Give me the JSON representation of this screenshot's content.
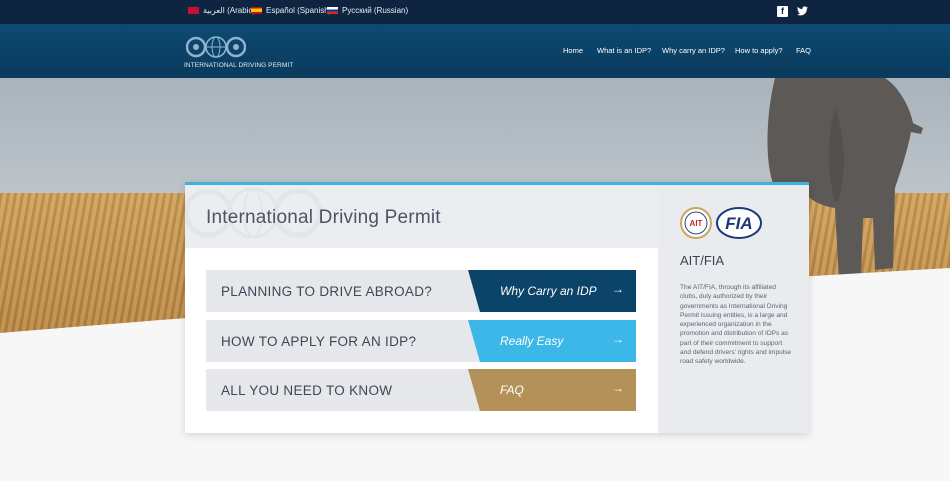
{
  "languages": [
    {
      "label": "العربية (Arabic)",
      "flag": "flag-ar"
    },
    {
      "label": "Español (Spanish)",
      "flag": "flag-es"
    },
    {
      "label": "Русский (Russian)",
      "flag": "flag-ru"
    }
  ],
  "social": {
    "facebook_icon": "f",
    "twitter_icon": "🐦"
  },
  "header": {
    "logo_text": "INTERNATIONAL DRIVING PERMIT",
    "nav": [
      "Home",
      "What is an IDP?",
      "Why carry an IDP?",
      "How to apply?",
      "FAQ"
    ]
  },
  "card": {
    "title": "International Driving Permit",
    "rows": [
      {
        "label": "PLANNING TO DRIVE ABROAD?",
        "button": "Why Carry an IDP",
        "arrow": "→",
        "color": "#0b4468"
      },
      {
        "label": "HOW TO APPLY FOR AN IDP?",
        "button": "Really Easy",
        "arrow": "→",
        "color": "#3bb8e8"
      },
      {
        "label": "ALL YOU NEED TO KNOW",
        "button": "FAQ",
        "arrow": "→",
        "color": "#b39159"
      }
    ]
  },
  "sidebar": {
    "ait_logo_text": "AIT",
    "fia_logo_text": "FIA",
    "title": "AIT/FIA",
    "text": "The AIT/FIA, through its affiliated clubs, duly authorized by their governments as International Driving Permit issuing entities, is a large and experienced organization in the promotion and distribution of IDPs as part of their commitment to support and defend drivers' rights and impulse road safety worldwide."
  },
  "colors": {
    "topbar": "#0e2440",
    "header": "#0d4a72",
    "accent": "#3bb3e0"
  }
}
